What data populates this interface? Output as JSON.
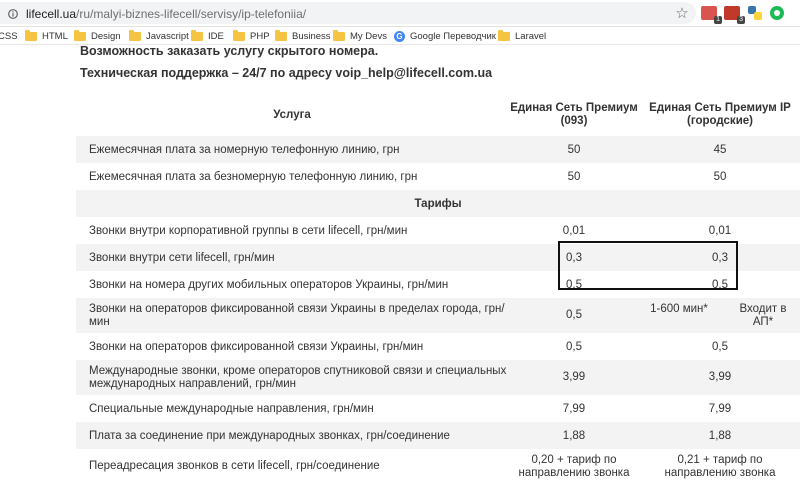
{
  "browser": {
    "url_host": "lifecell.ua",
    "url_path": "/ru/malyi-biznes-lifecell/servisy/ip-telefoniia/",
    "extension_badges": [
      "1",
      "3"
    ]
  },
  "bookmarks": [
    {
      "label": "CSS",
      "icon": "folder-icon"
    },
    {
      "label": "HTML",
      "icon": "folder-icon"
    },
    {
      "label": "Design",
      "icon": "folder-icon"
    },
    {
      "label": "Javascript",
      "icon": "folder-icon"
    },
    {
      "label": "IDE",
      "icon": "folder-icon"
    },
    {
      "label": "PHP",
      "icon": "folder-icon"
    },
    {
      "label": "Business",
      "icon": "folder-icon"
    },
    {
      "label": "My Devs",
      "icon": "folder-icon"
    },
    {
      "label": "Google Переводчик",
      "icon": "google-translate-icon"
    },
    {
      "label": "Laravel",
      "icon": "folder-icon"
    }
  ],
  "page": {
    "notice_1": "Возможность заказать услугу скрытого номера.",
    "notice_2": "Техническая поддержка – 24/7 по адресу voip_help@lifecell.com.ua",
    "table": {
      "headers": [
        "Услуга",
        "Единая Сеть Премиум (093)",
        "Единая Сеть Премиум IP (городские)"
      ],
      "rows": [
        {
          "service": "Ежемесячная плата за номерную телефонную линию, грн",
          "v1": "50",
          "v2": "45"
        },
        {
          "service": "Ежемесячная плата за безномерную телефонную линию, грн",
          "v1": "50",
          "v2": "50"
        }
      ],
      "section_title": "Тарифы",
      "tariff_rows": [
        {
          "service": "Звонки внутри корпоративной группы в сети lifecell, грн/мин",
          "v1": "0,01",
          "v2": "0,01"
        },
        {
          "service": "Звонки внутри сети lifecell, грн/мин",
          "v1": "0,3",
          "v2": "0,3"
        },
        {
          "service": "Звонки на номера других мобильных операторов Украины, грн/мин",
          "v1": "0,5",
          "v2": "0,5"
        },
        {
          "service": "Звонки на операторов фиксированной связи Украины в пределах города, грн/мин",
          "v1": "0,5",
          "v2a": "1-600 мин*",
          "v2b": "Входит в АП*"
        },
        {
          "service": "Звонки на операторов фиксированной связи Украины, грн/мин",
          "v1": "0,5",
          "v2": "0,5"
        },
        {
          "service": "Международные звонки, кроме операторов спутниковой связи и специальных международных направлений, грн/мин",
          "v1": "3,99",
          "v2": "3,99"
        },
        {
          "service": "Специальные международные направления, грн/мин",
          "v1": "7,99",
          "v2": "7,99"
        },
        {
          "service": "Плата за соединение при международных звонках, грн/соединение",
          "v1": "1,88",
          "v2": "1,88"
        },
        {
          "service": "Переадресация звонков в сети lifecell, грн/соединение",
          "v1": "0,20 + тариф по направлению звонка",
          "v2": "0,21 + тариф по направлению звонка"
        }
      ]
    }
  }
}
